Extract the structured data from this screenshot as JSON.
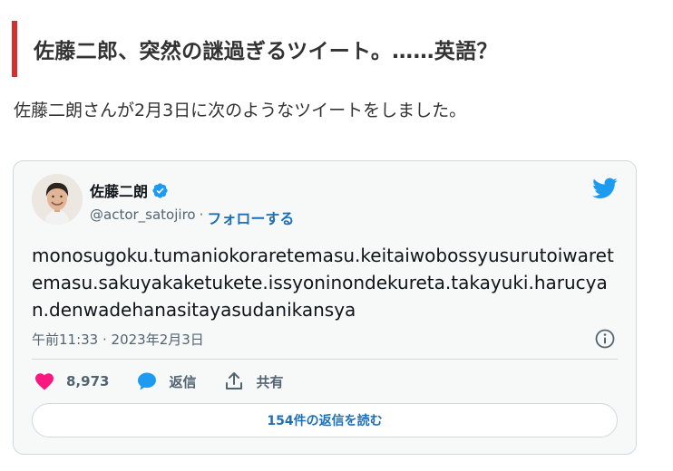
{
  "article": {
    "heading": "佐藤二郎、突然の謎過ぎるツイート。……英語？",
    "intro": "佐藤二朗さんが2月3日に次のようなツイートをしました。",
    "accent_color": "#d32f2f"
  },
  "tweet": {
    "author_name": "佐藤二朗",
    "verified": true,
    "handle": "@actor_satojiro",
    "separator": "·",
    "follow_label": "フォローする",
    "text": "monosugoku.tumaniokoraretemasu.keitaiwobossyusurutoiwaretemasu.sakuyakaketukete.issyoninondekureta.takayuki.harucyan.denwadehanasitayasudanikansya",
    "timestamp": "午前11:33 · 2023年2月3日",
    "like_count": "8,973",
    "reply_label": "返信",
    "share_label": "共有",
    "read_replies_label": "154件の返信を読む",
    "icons": {
      "avatar": "author-avatar",
      "verified": "verified-badge-icon",
      "brand": "twitter-bird-icon",
      "info": "info-icon",
      "like": "heart-icon",
      "reply": "speech-bubble-icon",
      "share": "share-icon"
    },
    "colors": {
      "link": "#1d6fb8",
      "twitter_blue": "#1d9bf0",
      "like_red": "#f91880"
    }
  }
}
